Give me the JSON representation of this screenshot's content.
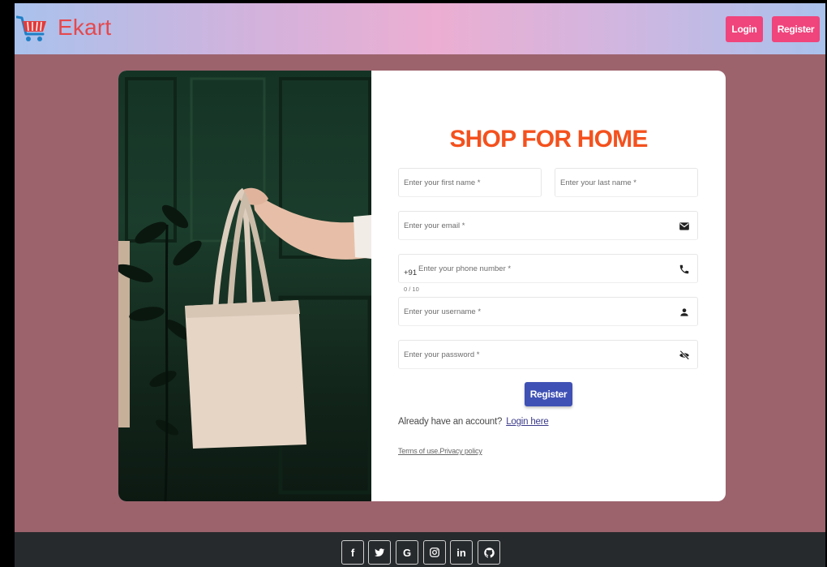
{
  "brand": {
    "name": "Ekart",
    "logo_icon": "shopping-cart-icon",
    "color": "#e5484d"
  },
  "navbar": {
    "login_label": "Login",
    "register_label": "Register"
  },
  "form": {
    "title": "SHOP FOR HOME",
    "first_name_placeholder": "Enter your first name *",
    "last_name_placeholder": "Enter your last name *",
    "email_placeholder": "Enter your email *",
    "phone_prefix": "+91",
    "phone_placeholder": "Enter your phone number *",
    "phone_counter": "0 / 10",
    "username_placeholder": "Enter your username *",
    "password_placeholder": "Enter your password *",
    "register_label": "Register",
    "already_text": "Already have an account?",
    "login_link": "Login here",
    "terms_text": "Terms of use.Privacy policy"
  },
  "footer": {
    "socials": [
      {
        "label": "f",
        "icon": "facebook-icon"
      },
      {
        "label": "",
        "icon": "twitter-icon"
      },
      {
        "label": "G",
        "icon": "google-icon"
      },
      {
        "label": "",
        "icon": "instagram-icon"
      },
      {
        "label": "in",
        "icon": "linkedin-icon"
      },
      {
        "label": "",
        "icon": "github-icon"
      }
    ]
  },
  "colors": {
    "page_bg": "#9c636d",
    "accent_pink": "#f0447c",
    "title_orange": "#f4511e",
    "primary_blue": "#3f51b5",
    "footer_bg": "#272a2d"
  }
}
